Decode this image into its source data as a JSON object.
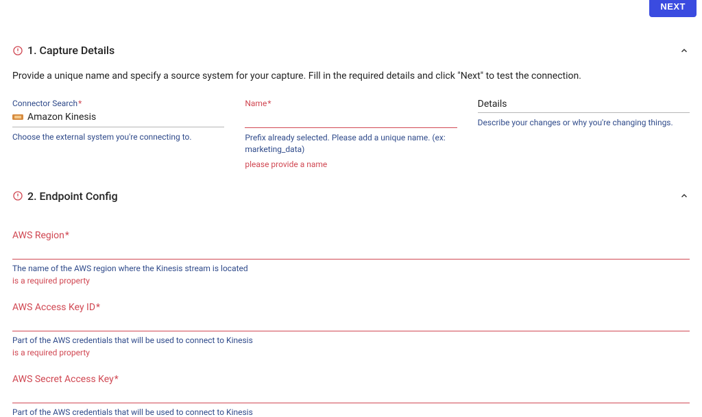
{
  "buttons": {
    "next": "NEXT"
  },
  "section1": {
    "title": "1. Capture Details",
    "description": "Provide a unique name and specify a source system for your capture. Fill in the required details and click \"Next\" to test the connection.",
    "connector": {
      "label": "Connector Search",
      "value": "Amazon Kinesis",
      "helper": "Choose the external system you're connecting to."
    },
    "name": {
      "label": "Name",
      "helper": "Prefix already selected. Please add a unique name. (ex: marketing_data)",
      "error": "please provide a name"
    },
    "details": {
      "label": "Details",
      "helper": "Describe your changes or why you're changing things."
    }
  },
  "section2": {
    "title": "2. Endpoint Config",
    "fields": [
      {
        "label": "AWS Region",
        "helper": "The name of the AWS region where the Kinesis stream is located",
        "error": "is a required property"
      },
      {
        "label": "AWS Access Key ID",
        "helper": "Part of the AWS credentials that will be used to connect to Kinesis",
        "error": "is a required property"
      },
      {
        "label": "AWS Secret Access Key",
        "helper": "Part of the AWS credentials that will be used to connect to Kinesis",
        "error": ""
      }
    ]
  }
}
